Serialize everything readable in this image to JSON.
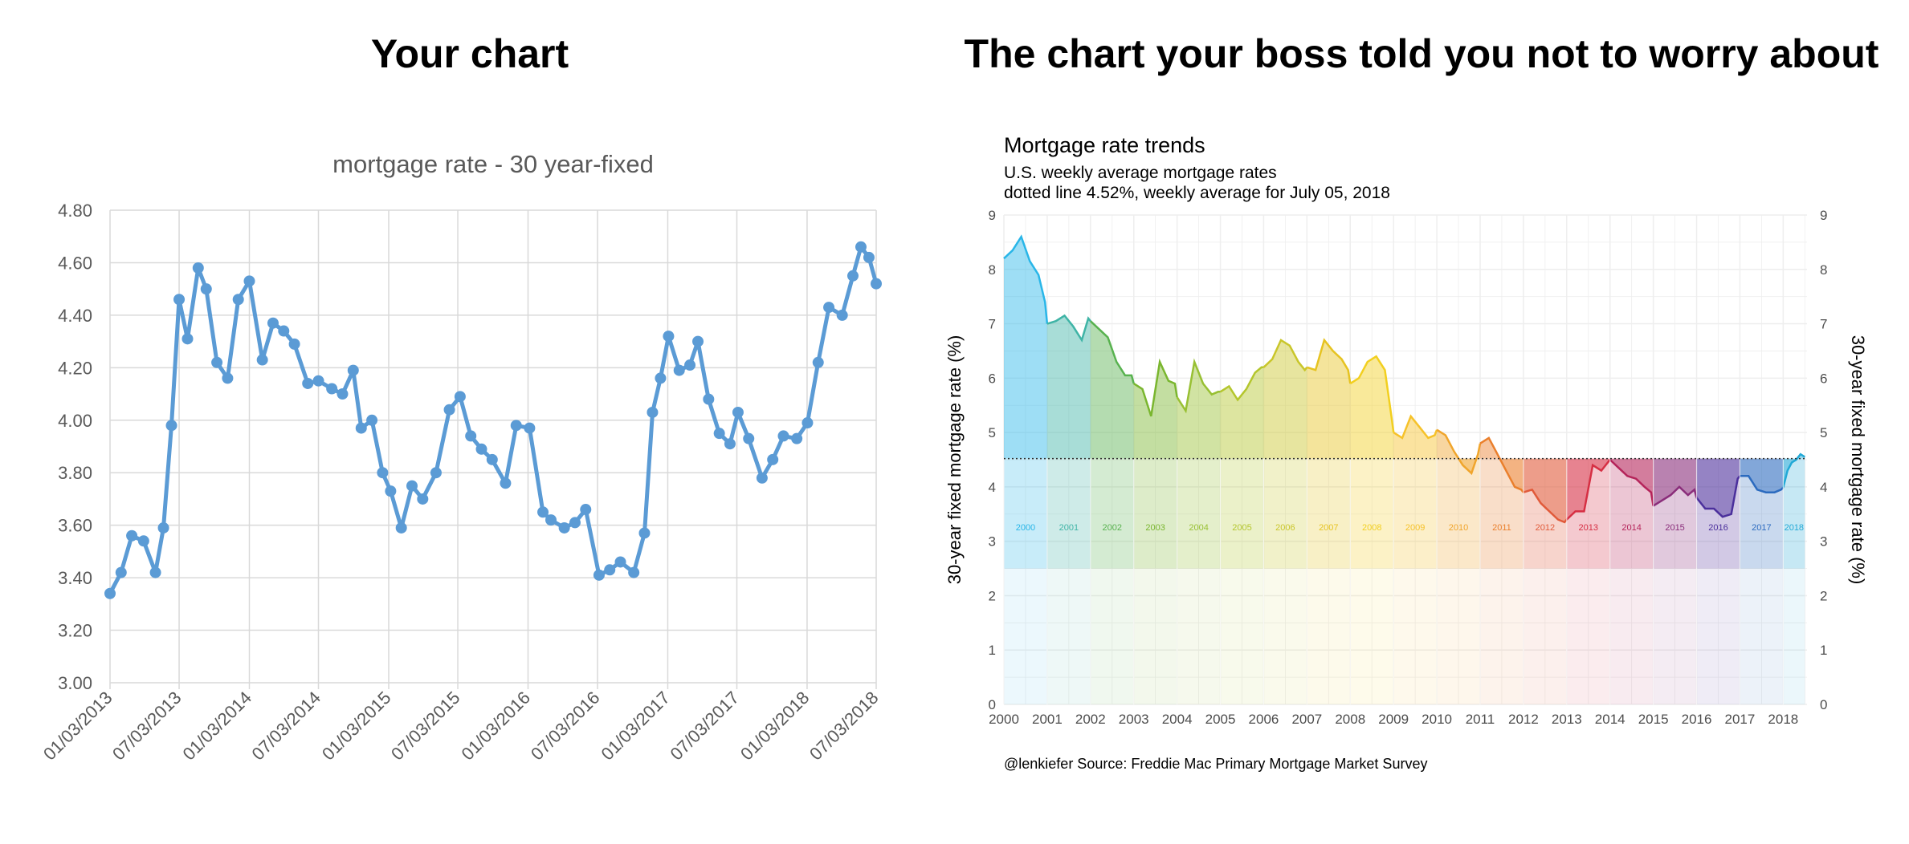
{
  "panels": {
    "left_title": "Your chart",
    "right_title": "The chart your boss told you not to worry about"
  },
  "chart_data": [
    {
      "type": "line",
      "title": "mortgage rate - 30 year-fixed",
      "color": "#5b9bd5",
      "markers": true,
      "grid": true,
      "ylim": [
        3.0,
        4.8
      ],
      "yticks": [
        "3.00",
        "3.20",
        "3.40",
        "3.60",
        "3.80",
        "4.00",
        "4.20",
        "4.40",
        "4.60",
        "4.80"
      ],
      "xlim": [
        "2013-01-03",
        "2018-07-03"
      ],
      "xticks": [
        "01/03/2013",
        "07/03/2013",
        "01/03/2014",
        "07/03/2014",
        "01/03/2015",
        "07/03/2015",
        "01/03/2016",
        "07/03/2016",
        "01/03/2017",
        "07/03/2017",
        "01/03/2018",
        "07/03/2018"
      ],
      "series": [
        {
          "x": [
            "2013-01-03",
            "2013-02-01",
            "2013-03-01",
            "2013-04-01",
            "2013-05-02",
            "2013-05-23",
            "2013-06-13",
            "2013-07-03",
            "2013-07-25",
            "2013-08-22",
            "2013-09-12",
            "2013-10-10",
            "2013-11-07",
            "2013-12-05",
            "2014-01-03",
            "2014-02-06",
            "2014-03-06",
            "2014-04-03",
            "2014-05-01",
            "2014-06-05",
            "2014-07-03",
            "2014-08-07",
            "2014-09-04",
            "2014-10-02",
            "2014-10-23",
            "2014-11-20",
            "2014-12-18",
            "2015-01-08",
            "2015-02-05",
            "2015-03-05",
            "2015-04-02",
            "2015-05-07",
            "2015-06-11",
            "2015-07-09",
            "2015-08-06",
            "2015-09-03",
            "2015-10-01",
            "2015-11-05",
            "2015-12-03",
            "2016-01-07",
            "2016-02-11",
            "2016-03-03",
            "2016-04-07",
            "2016-05-05",
            "2016-06-02",
            "2016-07-07",
            "2016-08-04",
            "2016-09-01",
            "2016-10-06",
            "2016-11-03",
            "2016-11-24",
            "2016-12-15",
            "2017-01-05",
            "2017-02-02",
            "2017-03-02",
            "2017-03-23",
            "2017-04-20",
            "2017-05-18",
            "2017-06-15",
            "2017-07-06",
            "2017-08-03",
            "2017-09-07",
            "2017-10-05",
            "2017-11-02",
            "2017-12-07",
            "2018-01-04",
            "2018-02-01",
            "2018-03-01",
            "2018-04-05",
            "2018-05-03",
            "2018-05-24",
            "2018-06-14",
            "2018-07-03"
          ],
          "y": [
            3.34,
            3.42,
            3.56,
            3.54,
            3.42,
            3.59,
            3.98,
            4.46,
            4.31,
            4.58,
            4.5,
            4.22,
            4.16,
            4.46,
            4.53,
            4.23,
            4.37,
            4.34,
            4.29,
            4.14,
            4.15,
            4.12,
            4.1,
            4.19,
            3.97,
            4.0,
            3.8,
            3.73,
            3.59,
            3.75,
            3.7,
            3.8,
            4.04,
            4.09,
            3.94,
            3.89,
            3.85,
            3.76,
            3.98,
            3.97,
            3.65,
            3.62,
            3.59,
            3.61,
            3.66,
            3.41,
            3.43,
            3.46,
            3.42,
            3.57,
            4.03,
            4.16,
            4.32,
            4.19,
            4.21,
            4.3,
            4.08,
            3.95,
            3.91,
            4.03,
            3.93,
            3.78,
            3.85,
            3.94,
            3.93,
            3.99,
            4.22,
            4.43,
            4.4,
            4.55,
            4.66,
            4.62,
            4.52
          ]
        }
      ]
    },
    {
      "type": "area",
      "title": "Mortgage rate trends",
      "subtitle_lines": [
        "U.S. weekly average mortgage rates",
        "dotted line 4.52%, weekly average for July 05, 2018"
      ],
      "ylabel": "30-year fixed mortgage rate (%)",
      "ylabel_right": "30-year fixed mortgage rate (%)",
      "ylim": [
        0,
        9
      ],
      "yticks": [
        "0",
        "1",
        "2",
        "3",
        "4",
        "5",
        "6",
        "7",
        "8",
        "9"
      ],
      "xlim": [
        2000,
        2018.55
      ],
      "xticks": [
        "2000",
        "2001",
        "2002",
        "2003",
        "2004",
        "2005",
        "2006",
        "2007",
        "2008",
        "2009",
        "2010",
        "2011",
        "2012",
        "2013",
        "2014",
        "2015",
        "2016",
        "2017",
        "2018"
      ],
      "reference_line": 4.52,
      "caption": "@lenkiefer Source: Freddie Mac Primary Mortgage Market Survey",
      "grid": true,
      "years": [
        {
          "label": "2000",
          "color": "#29b6e8",
          "x": [
            2000,
            2000.2,
            2000.4,
            2000.6,
            2000.8,
            2000.95
          ],
          "y": [
            8.2,
            8.35,
            8.6,
            8.15,
            7.9,
            7.4
          ]
        },
        {
          "label": "2001",
          "color": "#3fb4a6",
          "x": [
            2001,
            2001.2,
            2001.4,
            2001.6,
            2001.8,
            2001.95
          ],
          "y": [
            7.0,
            7.05,
            7.15,
            6.95,
            6.7,
            7.1
          ]
        },
        {
          "label": "2002",
          "color": "#58b24f",
          "x": [
            2002,
            2002.2,
            2002.4,
            2002.6,
            2002.8,
            2002.95
          ],
          "y": [
            7.05,
            6.9,
            6.75,
            6.3,
            6.05,
            6.05
          ]
        },
        {
          "label": "2003",
          "color": "#7ab62f",
          "x": [
            2003,
            2003.2,
            2003.4,
            2003.6,
            2003.8,
            2003.95
          ],
          "y": [
            5.9,
            5.8,
            5.3,
            6.3,
            5.95,
            5.9
          ]
        },
        {
          "label": "2004",
          "color": "#98c033",
          "x": [
            2004,
            2004.2,
            2004.4,
            2004.6,
            2004.8,
            2004.95
          ],
          "y": [
            5.65,
            5.4,
            6.3,
            5.9,
            5.7,
            5.75
          ]
        },
        {
          "label": "2005",
          "color": "#b4c62d",
          "x": [
            2005,
            2005.2,
            2005.4,
            2005.6,
            2005.8,
            2005.95
          ],
          "y": [
            5.75,
            5.85,
            5.6,
            5.8,
            6.1,
            6.2
          ]
        },
        {
          "label": "2006",
          "color": "#c9c62a",
          "x": [
            2006,
            2006.2,
            2006.4,
            2006.6,
            2006.8,
            2006.95
          ],
          "y": [
            6.2,
            6.35,
            6.7,
            6.6,
            6.3,
            6.15
          ]
        },
        {
          "label": "2007",
          "color": "#e6c321",
          "x": [
            2007,
            2007.2,
            2007.4,
            2007.6,
            2007.8,
            2007.95
          ],
          "y": [
            6.2,
            6.15,
            6.7,
            6.5,
            6.35,
            6.15
          ]
        },
        {
          "label": "2008",
          "color": "#f2cf1f",
          "x": [
            2008,
            2008.2,
            2008.4,
            2008.6,
            2008.8,
            2008.95
          ],
          "y": [
            5.9,
            6.0,
            6.3,
            6.4,
            6.15,
            5.3
          ]
        },
        {
          "label": "2009",
          "color": "#f6c22a",
          "x": [
            2009,
            2009.2,
            2009.4,
            2009.6,
            2009.8,
            2009.95
          ],
          "y": [
            5.0,
            4.9,
            5.3,
            5.1,
            4.9,
            4.95
          ]
        },
        {
          "label": "2010",
          "color": "#f0a52c",
          "x": [
            2010,
            2010.2,
            2010.4,
            2010.6,
            2010.8,
            2010.95
          ],
          "y": [
            5.05,
            4.95,
            4.65,
            4.4,
            4.25,
            4.6
          ]
        },
        {
          "label": "2011",
          "color": "#ea7f2c",
          "x": [
            2011,
            2011.2,
            2011.4,
            2011.6,
            2011.8,
            2011.95
          ],
          "y": [
            4.8,
            4.9,
            4.6,
            4.3,
            4.0,
            3.95
          ]
        },
        {
          "label": "2012",
          "color": "#e15a3a",
          "x": [
            2012,
            2012.2,
            2012.4,
            2012.6,
            2012.8,
            2012.95
          ],
          "y": [
            3.9,
            3.95,
            3.7,
            3.55,
            3.4,
            3.35
          ]
        },
        {
          "label": "2013",
          "color": "#d62f43",
          "x": [
            2013,
            2013.2,
            2013.4,
            2013.6,
            2013.8,
            2013.95
          ],
          "y": [
            3.4,
            3.55,
            3.55,
            4.4,
            4.3,
            4.45
          ]
        },
        {
          "label": "2014",
          "color": "#b5245a",
          "x": [
            2014,
            2014.2,
            2014.4,
            2014.6,
            2014.8,
            2014.95
          ],
          "y": [
            4.5,
            4.35,
            4.2,
            4.15,
            4.0,
            3.9
          ]
        },
        {
          "label": "2015",
          "color": "#8a2d7a",
          "x": [
            2015,
            2015.2,
            2015.4,
            2015.6,
            2015.8,
            2015.95
          ],
          "y": [
            3.65,
            3.75,
            3.85,
            4.0,
            3.85,
            3.95
          ]
        },
        {
          "label": "2016",
          "color": "#4b2f9c",
          "x": [
            2016,
            2016.2,
            2016.4,
            2016.6,
            2016.8,
            2016.95
          ],
          "y": [
            3.8,
            3.6,
            3.6,
            3.45,
            3.5,
            4.15
          ]
        },
        {
          "label": "2017",
          "color": "#2c6bbf",
          "x": [
            2017,
            2017.2,
            2017.4,
            2017.6,
            2017.8,
            2017.95
          ],
          "y": [
            4.2,
            4.2,
            3.95,
            3.9,
            3.9,
            3.95
          ]
        },
        {
          "label": "2018",
          "color": "#22a9d6",
          "x": [
            2018,
            2018.1,
            2018.2,
            2018.3,
            2018.4,
            2018.5
          ],
          "y": [
            3.99,
            4.3,
            4.45,
            4.5,
            4.6,
            4.55
          ]
        }
      ]
    }
  ]
}
